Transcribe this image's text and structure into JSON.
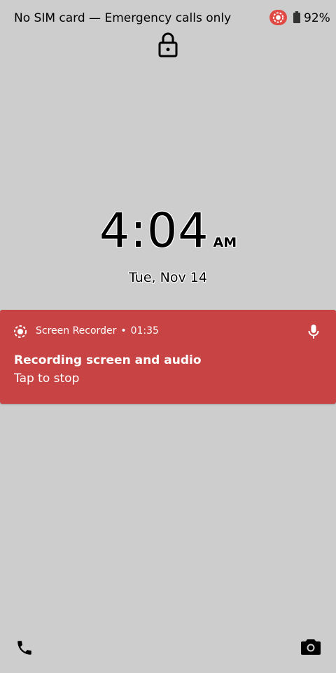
{
  "status_bar": {
    "carrier_text": "No SIM card — Emergency calls only",
    "battery_percent": "92%",
    "battery_level": 0.92,
    "icons": [
      "screen-record-icon",
      "battery-icon"
    ],
    "recording_indicator_color": "#e04a45"
  },
  "lock": {
    "icon": "lock-icon"
  },
  "clock": {
    "time": "4:04",
    "ampm": "AM",
    "date": "Tue, Nov 14"
  },
  "notification": {
    "app_name": "Screen Recorder",
    "separator": "•",
    "elapsed": "01:35",
    "title": "Recording screen and audio",
    "text": "Tap to stop",
    "background_color": "#c84444",
    "icons": [
      "screen-record-icon",
      "microphone-icon"
    ]
  },
  "shortcuts": {
    "left_icon": "phone-icon",
    "right_icon": "camera-icon"
  }
}
